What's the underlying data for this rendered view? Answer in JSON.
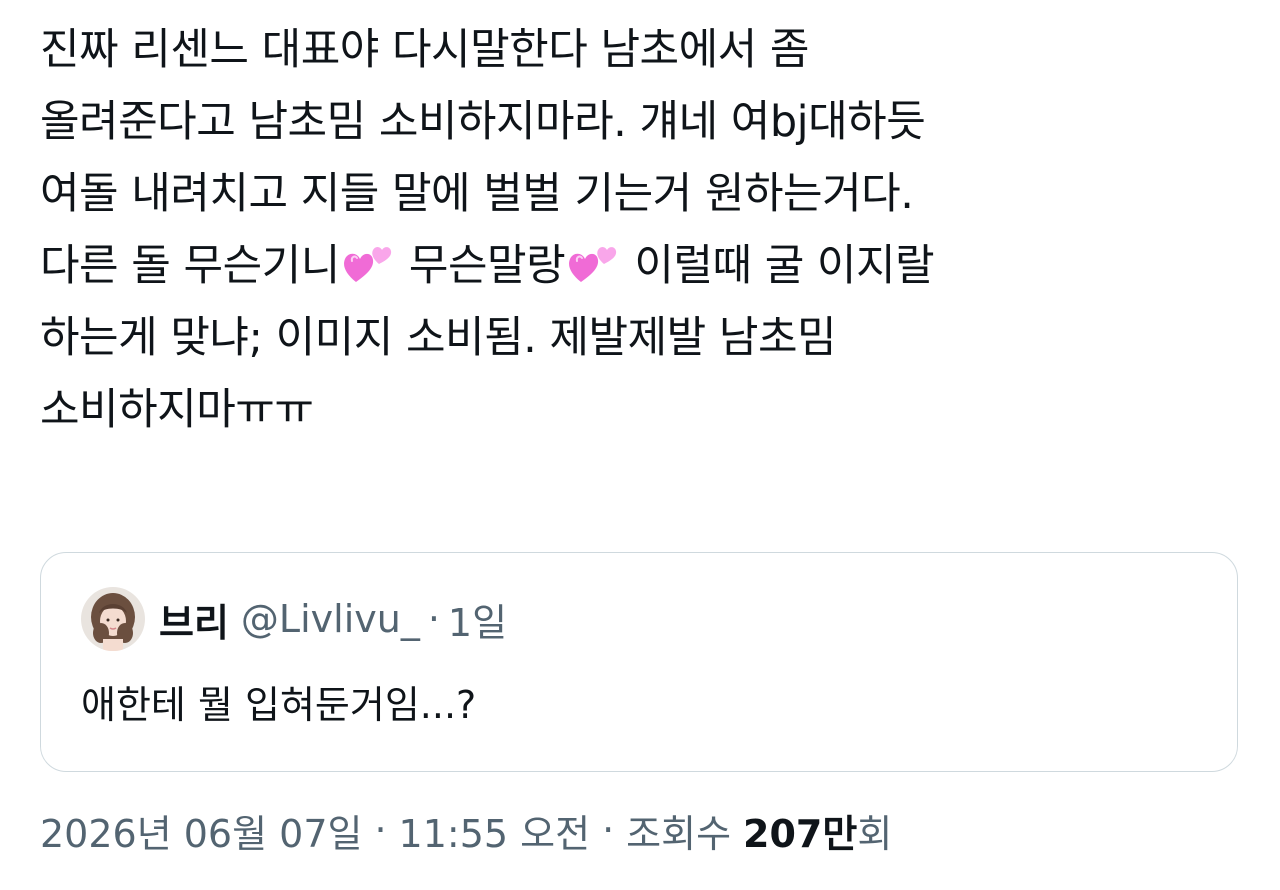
{
  "tweet": {
    "lines": [
      "진짜 리센느 대표야 다시말한다 남초에서 좀",
      "올려준다고 남초밈 소비하지마라. 걔네 여bj대하듯",
      "여돌 내려치고 지들 말에 벌벌 기는거 원하는거다.",
      {
        "seg1": "다른 돌 무슨기니",
        "seg2": " 무슨말랑",
        "seg3": " 이럴때 굴 이지랄"
      },
      "하는게 맞냐; 이미지 소비됨. 제발제발 남초밈",
      "소비하지마ㅠㅠ"
    ],
    "emoji": {
      "name": "two-hearts-icon",
      "color_main": "#f06bd6",
      "color_light": "#f9a6ea"
    }
  },
  "quote": {
    "name": "브리",
    "handle": "@Livlivu_",
    "separator": "·",
    "time": "1일",
    "text": "애한테 뭘 입혀둔거임...?"
  },
  "meta": {
    "date": "2026년 06월 07일",
    "separator": "·",
    "time": "11:55 오전",
    "views_label": "조회수",
    "views_count": "207만",
    "views_suffix": "회"
  },
  "colors": {
    "text_primary": "#0f1419",
    "text_secondary": "#536471",
    "border": "#cfd9de"
  }
}
